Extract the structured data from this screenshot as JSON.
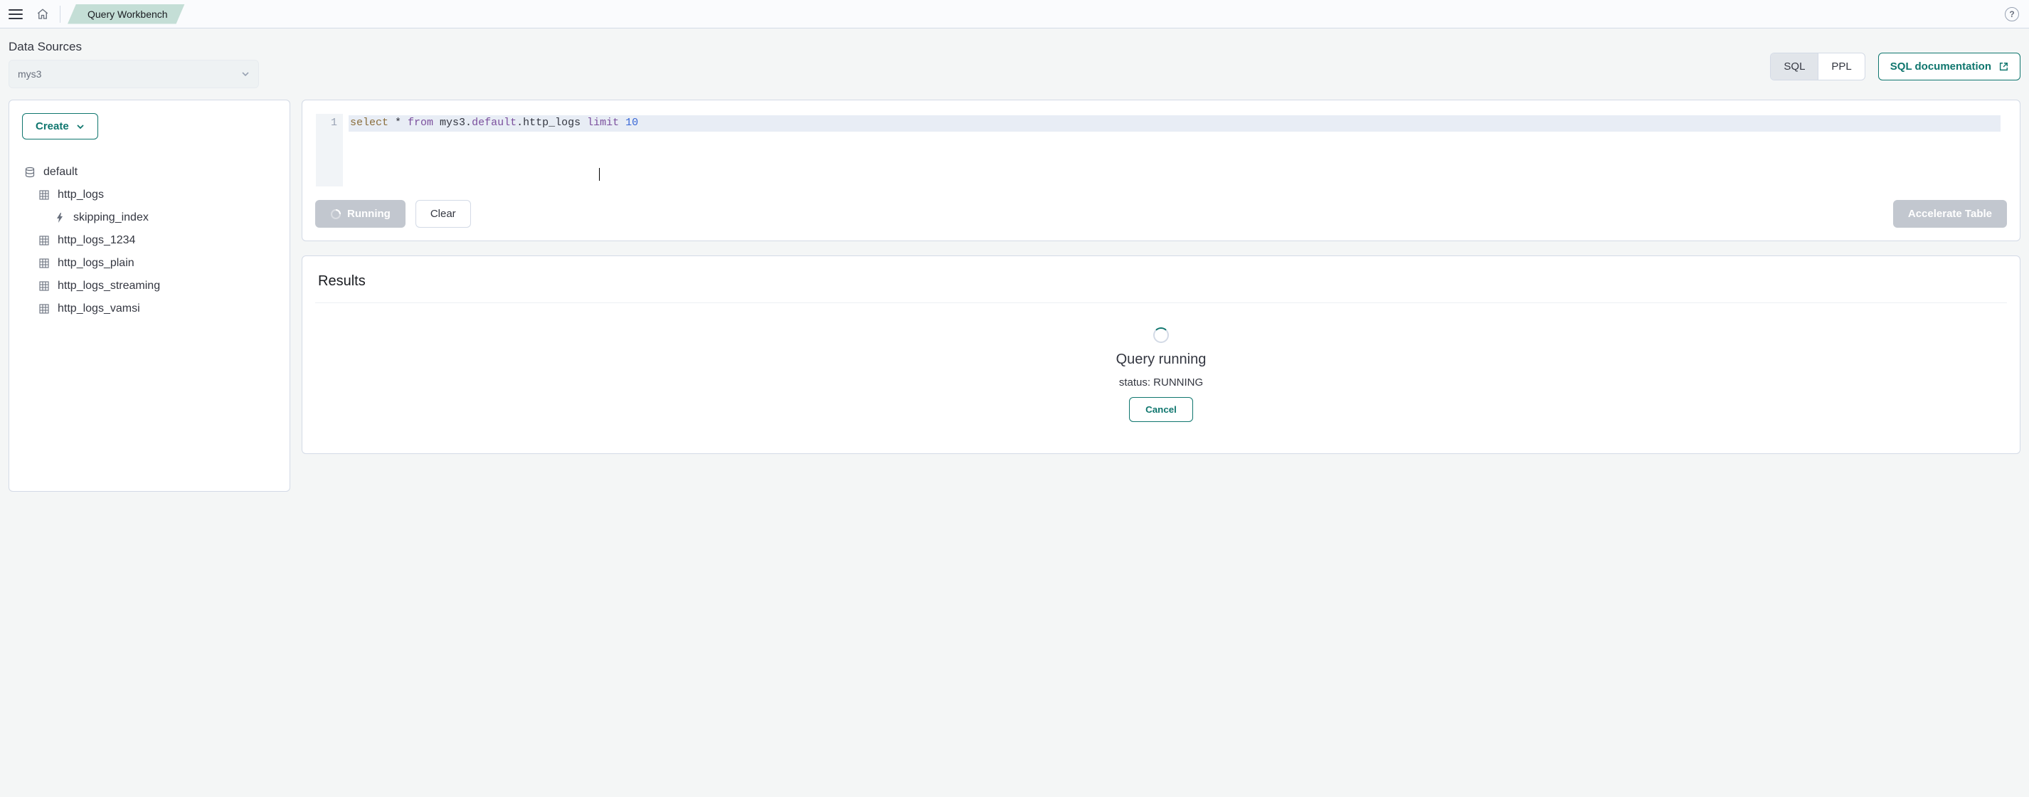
{
  "topbar": {
    "breadcrumb": "Query Workbench"
  },
  "data_sources": {
    "label": "Data Sources",
    "selected": "mys3"
  },
  "lang_toggle": {
    "sql": "SQL",
    "ppl": "PPL"
  },
  "doc_button": "SQL documentation",
  "create_button": "Create",
  "tree": {
    "db": "default",
    "tables": [
      {
        "name": "http_logs",
        "indexes": [
          "skipping_index"
        ]
      },
      {
        "name": "http_logs_1234"
      },
      {
        "name": "http_logs_plain"
      },
      {
        "name": "http_logs_streaming"
      },
      {
        "name": "http_logs_vamsi"
      }
    ]
  },
  "editor": {
    "line_no": "1",
    "tokens": {
      "select": "select",
      "star": " * ",
      "from": "from",
      "ds": " mys3.",
      "schema": "default",
      "table": ".http_logs ",
      "limit": "limit",
      "sp": " ",
      "num": "10"
    }
  },
  "buttons": {
    "running": "Running",
    "clear": "Clear",
    "accelerate": "Accelerate Table"
  },
  "results": {
    "title": "Results",
    "running_title": "Query running",
    "status": "status: RUNNING",
    "cancel": "Cancel"
  }
}
